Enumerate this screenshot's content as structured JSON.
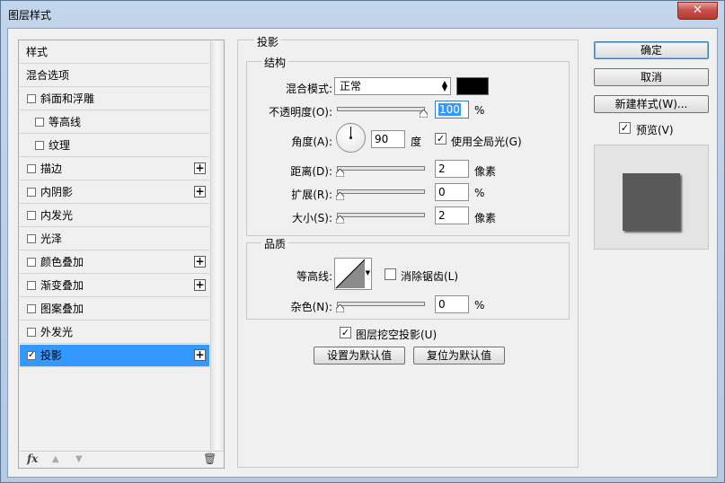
{
  "window": {
    "title": "图层样式",
    "close_label": "✕"
  },
  "sidebar": {
    "items": [
      {
        "label": "样式",
        "checkbox": false,
        "checked": false,
        "plus": false,
        "indent": 0
      },
      {
        "label": "混合选项",
        "checkbox": false,
        "checked": false,
        "plus": false,
        "indent": 0
      },
      {
        "label": "斜面和浮雕",
        "checkbox": true,
        "checked": false,
        "plus": false,
        "indent": 0
      },
      {
        "label": "等高线",
        "checkbox": true,
        "checked": false,
        "plus": false,
        "indent": 1
      },
      {
        "label": "纹理",
        "checkbox": true,
        "checked": false,
        "plus": false,
        "indent": 1
      },
      {
        "label": "描边",
        "checkbox": true,
        "checked": false,
        "plus": true,
        "indent": 0
      },
      {
        "label": "内阴影",
        "checkbox": true,
        "checked": false,
        "plus": true,
        "indent": 0
      },
      {
        "label": "内发光",
        "checkbox": true,
        "checked": false,
        "plus": false,
        "indent": 0
      },
      {
        "label": "光泽",
        "checkbox": true,
        "checked": false,
        "plus": false,
        "indent": 0
      },
      {
        "label": "颜色叠加",
        "checkbox": true,
        "checked": false,
        "plus": true,
        "indent": 0
      },
      {
        "label": "渐变叠加",
        "checkbox": true,
        "checked": false,
        "plus": true,
        "indent": 0
      },
      {
        "label": "图案叠加",
        "checkbox": true,
        "checked": false,
        "plus": false,
        "indent": 0
      },
      {
        "label": "外发光",
        "checkbox": true,
        "checked": false,
        "plus": false,
        "indent": 0
      },
      {
        "label": "投影",
        "checkbox": true,
        "checked": true,
        "plus": true,
        "indent": 0,
        "selected": true
      }
    ],
    "toolbar": {
      "fx_label": "fx",
      "up_icon": "▲",
      "down_icon": "▼",
      "trash_icon": "🗑"
    }
  },
  "main": {
    "section_title": "投影",
    "structure": {
      "title": "结构",
      "blend_mode_label": "混合模式:",
      "blend_mode_value": "正常",
      "blend_color": "#000000",
      "opacity_label": "不透明度(O):",
      "opacity_value": "100",
      "opacity_fraction": 1.0,
      "opacity_unit": "%",
      "angle_label": "角度(A):",
      "angle_value": "90",
      "angle_unit": "度",
      "global_light_label": "使用全局光(G)",
      "global_light_checked": true,
      "distance_label": "距离(D):",
      "distance_value": "2",
      "distance_fraction": 0.0,
      "distance_unit": "像素",
      "spread_label": "扩展(R):",
      "spread_value": "0",
      "spread_fraction": 0.0,
      "spread_unit": "%",
      "size_label": "大小(S):",
      "size_value": "2",
      "size_fraction": 0.0,
      "size_unit": "像素"
    },
    "quality": {
      "title": "品质",
      "contour_label": "等高线:",
      "anti_alias_label": "消除锯齿(L)",
      "anti_alias_checked": false,
      "noise_label": "杂色(N):",
      "noise_value": "0",
      "noise_fraction": 0.0,
      "noise_unit": "%"
    },
    "knockout_label": "图层挖空投影(U)",
    "knockout_checked": true,
    "set_default_label": "设置为默认值",
    "reset_default_label": "复位为默认值"
  },
  "right": {
    "ok_label": "确定",
    "cancel_label": "取消",
    "new_style_label": "新建样式(W)...",
    "preview_label": "预览(V)",
    "preview_checked": true
  }
}
